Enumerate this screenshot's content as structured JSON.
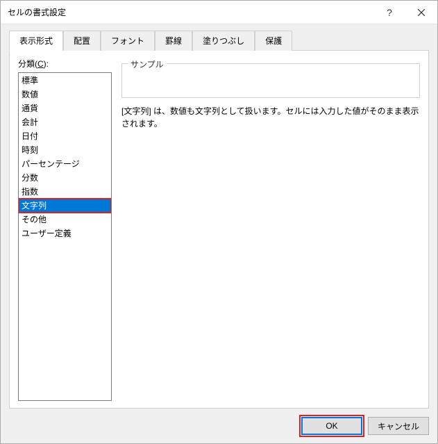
{
  "window": {
    "title": "セルの書式設定"
  },
  "tabs": {
    "items": [
      {
        "label": "表示形式",
        "active": true
      },
      {
        "label": "配置",
        "active": false
      },
      {
        "label": "フォント",
        "active": false
      },
      {
        "label": "罫線",
        "active": false
      },
      {
        "label": "塗りつぶし",
        "active": false
      },
      {
        "label": "保護",
        "active": false
      }
    ]
  },
  "category": {
    "label_prefix": "分類(",
    "label_mnemonic": "C",
    "label_suffix": "):",
    "items": [
      "標準",
      "数値",
      "通貨",
      "会計",
      "日付",
      "時刻",
      "パーセンテージ",
      "分数",
      "指数",
      "文字列",
      "その他",
      "ユーザー定義"
    ],
    "selected_index": 9
  },
  "sample": {
    "legend": "サンプル",
    "value": ""
  },
  "description": "[文字列] は、数値も文字列として扱います。セルには入力した値がそのまま表示されます。",
  "buttons": {
    "ok": "OK",
    "cancel": "キャンセル"
  }
}
